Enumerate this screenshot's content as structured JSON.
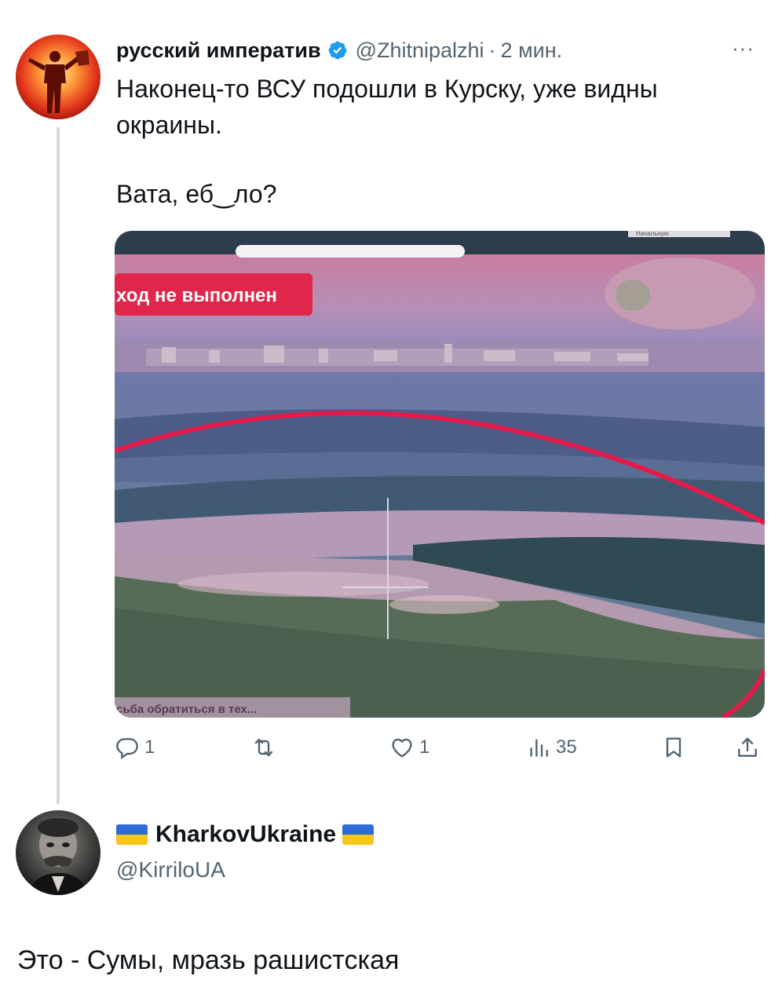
{
  "tweet": {
    "display_name": "русский императив",
    "handle": "@Zhitnipalzhi",
    "separator": "·",
    "time": "2 мин.",
    "more_label": "···",
    "text_line1": "Наконец-то ВСУ подошли в Курску, уже видны окраины.",
    "text_line2": "Вата, еб‿ло?",
    "media": {
      "banner_text": "ход не выполнен",
      "bottom_text": "сьба обратиться в тех...",
      "top_right_text": "Начальную"
    },
    "actions": {
      "replies": "1",
      "retweets": "",
      "likes": "1",
      "views": "35"
    }
  },
  "reply": {
    "display_name": "KharkovUkraine",
    "handle": "@KirriloUA",
    "text": "Это - Сумы, мразь рашистская"
  },
  "colors": {
    "text": "#0f1419",
    "secondary": "#536471",
    "verified": "#1d9bf0",
    "thread_line": "#cfd9de",
    "banner": "#e0264a"
  }
}
